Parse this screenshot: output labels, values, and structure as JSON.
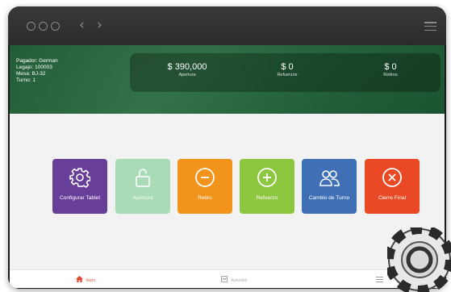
{
  "header": {
    "pagador": "Pagador: German",
    "legajo": "Legajo: 100003",
    "mesa": "Mesa: BJ-32",
    "turno": "Turno: 1"
  },
  "stats": [
    {
      "value": "$ 390,000",
      "label": "Apertura"
    },
    {
      "value": "$ 0",
      "label": "Refuerzos"
    },
    {
      "value": "$ 0",
      "label": "Retiros"
    }
  ],
  "tiles": [
    {
      "label": "Configurar Tablet",
      "color": "#673e98",
      "icon": "gear-icon",
      "enabled": true
    },
    {
      "label": "Apertura",
      "color": "#a8dbb6",
      "icon": "unlock-icon",
      "enabled": false
    },
    {
      "label": "Retiro",
      "color": "#f2931b",
      "icon": "minus-circle-icon",
      "enabled": true
    },
    {
      "label": "Refuerzo",
      "color": "#8dc63f",
      "icon": "plus-circle-icon",
      "enabled": true
    },
    {
      "label": "Cambio de Turno",
      "color": "#3f6fb5",
      "icon": "users-icon",
      "enabled": true
    },
    {
      "label": "Cierre Final",
      "color": "#e94a25",
      "icon": "close-circle-icon",
      "enabled": true
    }
  ],
  "bottom_nav": [
    {
      "label": "Inicio",
      "icon": "home-icon",
      "active": true
    },
    {
      "label": "Actividad",
      "icon": "activity-icon",
      "active": false
    },
    {
      "label": "",
      "icon": "menu-icon",
      "active": false
    }
  ]
}
